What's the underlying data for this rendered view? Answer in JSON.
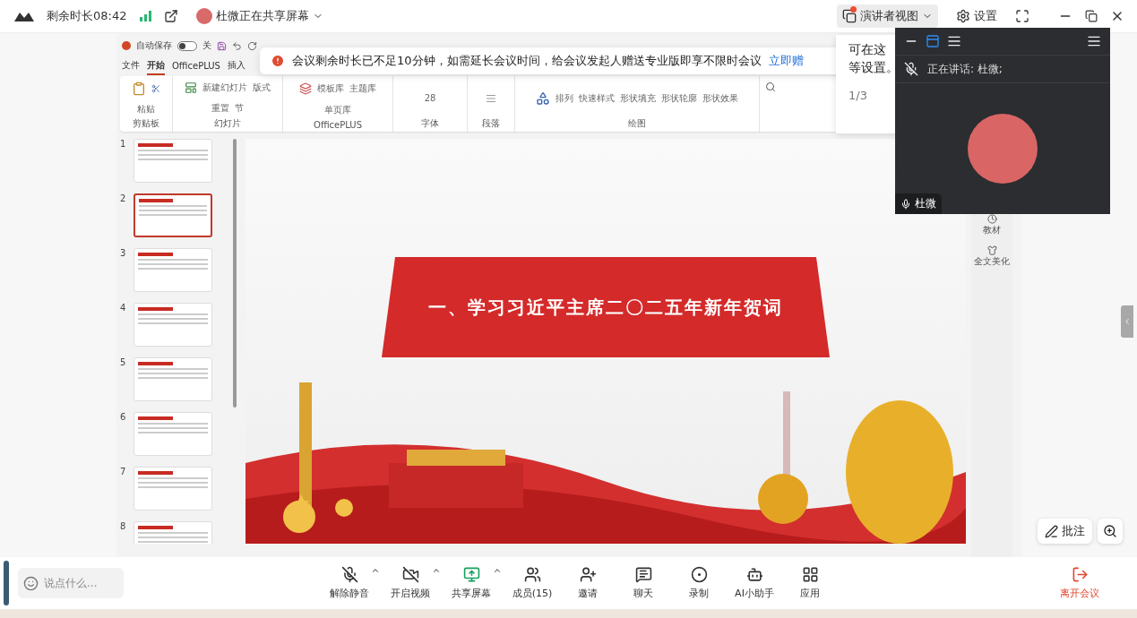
{
  "top_bar": {
    "remaining": "剩余时长08:42",
    "sharer": "杜微正在共享屏幕",
    "presenter_view": {
      "label": "演讲者视图",
      "notified": true
    },
    "settings": "设置"
  },
  "ppt": {
    "autosave": "自动保存",
    "autosave_state": "关",
    "autosave_on": false,
    "tabs": [
      {
        "label": "文件",
        "selected": false
      },
      {
        "label": "开始",
        "selected": true
      },
      {
        "label": "OfficePLUS",
        "selected": false
      },
      {
        "label": "插入",
        "selected": false
      }
    ],
    "ribbon_groups": [
      {
        "label": "剪贴板",
        "items": [
          "粘贴"
        ]
      },
      {
        "label": "幻灯片",
        "items": [
          "新建幻灯片",
          "版式",
          "重置",
          "节"
        ]
      },
      {
        "label": "OfficePLUS",
        "items": [
          "模板库",
          "主题库",
          "单页库"
        ]
      },
      {
        "label": "字体",
        "items": [
          "28"
        ]
      },
      {
        "label": "段落"
      },
      {
        "label": "绘图",
        "items": [
          "排列",
          "快速样式",
          "形状填充",
          "形状轮廓",
          "形状效果"
        ]
      }
    ],
    "thumbnails": [
      {
        "number": "1",
        "selected": false
      },
      {
        "number": "2",
        "selected": true
      },
      {
        "number": "3",
        "selected": false
      },
      {
        "number": "4",
        "selected": false
      },
      {
        "number": "5",
        "selected": false
      },
      {
        "number": "6",
        "selected": false
      },
      {
        "number": "7",
        "selected": false
      },
      {
        "number": "8",
        "selected": false
      }
    ],
    "slide_title": "一、学习习近平主席二〇二五年新年贺词",
    "side_tools": [
      "教材",
      "全文美化"
    ]
  },
  "banner": {
    "text": "会议剩余时长已不足10分钟，如需延长会议时间，给会议发起人赠送专业版即享不限时会议",
    "link": "立即赠"
  },
  "tip": {
    "line_1": "可在这",
    "line_2": "等设置。",
    "page": "1/3"
  },
  "video_panel": {
    "speaking": "正在讲话:  杜微;",
    "name": "杜微"
  },
  "annotate": "批注",
  "chat_placeholder": "说点什么...",
  "toolbar": [
    {
      "kind": "mic",
      "label": "解除静音",
      "on": false,
      "menu": true
    },
    {
      "kind": "video",
      "label": "开启视频",
      "on": false,
      "menu": true
    },
    {
      "kind": "share",
      "label": "共享屏幕",
      "menu": true
    },
    {
      "kind": "members",
      "label": "成员(15)"
    },
    {
      "kind": "invite",
      "label": "邀请"
    },
    {
      "kind": "chat",
      "label": "聊天"
    },
    {
      "kind": "record",
      "label": "录制"
    },
    {
      "kind": "ai",
      "label": "AI小助手"
    },
    {
      "kind": "apps",
      "label": "应用"
    }
  ],
  "leave": "离开会议"
}
